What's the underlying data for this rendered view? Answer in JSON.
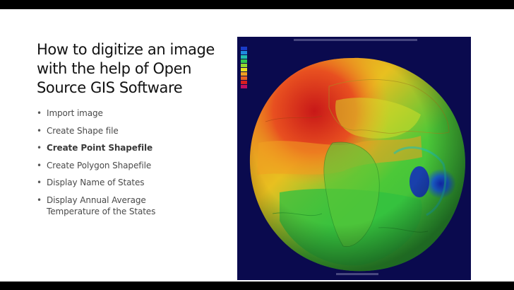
{
  "slide": {
    "title_lines": [
      "How to digitize an image",
      "with the help of Open",
      "Source GIS Software"
    ],
    "bullets": [
      {
        "lines": [
          "Import image"
        ],
        "bold": false
      },
      {
        "lines": [
          "Create Shape file"
        ],
        "bold": false
      },
      {
        "lines": [
          "Create Point Shapefile"
        ],
        "bold": true
      },
      {
        "lines": [
          "Create Polygon Shapefile"
        ],
        "bold": false
      },
      {
        "lines": [
          "Display Name of States"
        ],
        "bold": false
      },
      {
        "lines": [
          "Display Annual Average",
          "Temperature of the States"
        ],
        "bold": false
      }
    ],
    "bullet_glyph": "•"
  },
  "figure": {
    "subject": "geoid-globe-image",
    "colors": {
      "background": "#0a0a4e",
      "high": "#d8241c",
      "mid_high": "#f29a1c",
      "mid": "#e8e020",
      "low": "#2ec83c",
      "lowest": "#1a40d0"
    },
    "legend_colors": [
      "#1a3cc8",
      "#1e8ce0",
      "#20c0b0",
      "#30c850",
      "#90d830",
      "#e8e020",
      "#f0a020",
      "#e86020",
      "#d82020",
      "#c01060"
    ]
  }
}
